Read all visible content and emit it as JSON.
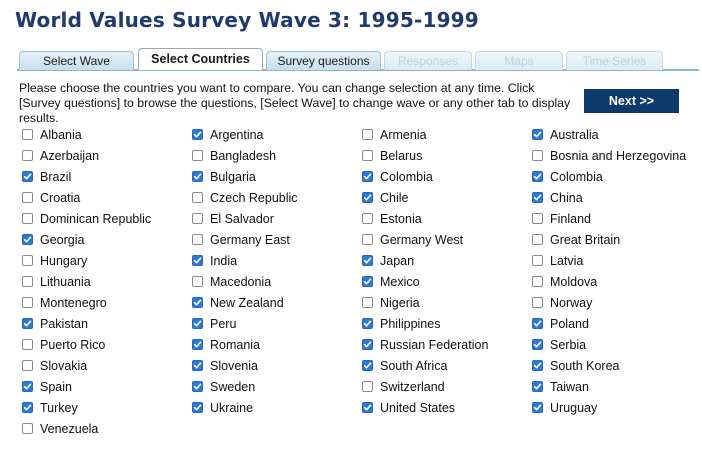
{
  "page": {
    "title": "World Values Survey Wave 3: 1995-1999"
  },
  "tabs": [
    {
      "label": "Select Wave",
      "state": "normal"
    },
    {
      "label": "Select Countries",
      "state": "active"
    },
    {
      "label": "Survey questions",
      "state": "normal"
    },
    {
      "label": "Responses",
      "state": "disabled"
    },
    {
      "label": "Maps",
      "state": "disabled"
    },
    {
      "label": "Time Series",
      "state": "disabled"
    }
  ],
  "instructions": "Please choose the countries you want to compare. You can change selection at any time. Click [Survey questions] to browse the questions, [Select Wave] to change wave or any other tab to display results.",
  "next_button": {
    "label": "Next >>"
  },
  "colors": {
    "title": "#1f3a6e",
    "next_button_bg": "#0d3a6b",
    "checkbox_checked": "#2d7ad6"
  },
  "countries": [
    [
      "Albania",
      false
    ],
    [
      "Argentina",
      true
    ],
    [
      "Armenia",
      false
    ],
    [
      "Australia",
      true
    ],
    [
      "Azerbaijan",
      false
    ],
    [
      "Bangladesh",
      false
    ],
    [
      "Belarus",
      false
    ],
    [
      "Bosnia and Herzegovina",
      false
    ],
    [
      "Brazil",
      true
    ],
    [
      "Bulgaria",
      true
    ],
    [
      "Colombia",
      true
    ],
    [
      "Colombia",
      true
    ],
    [
      "Croatia",
      false
    ],
    [
      "Czech Republic",
      false
    ],
    [
      "Chile",
      true
    ],
    [
      "China",
      true
    ],
    [
      "Dominican Republic",
      false
    ],
    [
      "El Salvador",
      false
    ],
    [
      "Estonia",
      false
    ],
    [
      "Finland",
      false
    ],
    [
      "Georgia",
      true
    ],
    [
      "Germany East",
      false
    ],
    [
      "Germany West",
      false
    ],
    [
      "Great Britain",
      false
    ],
    [
      "Hungary",
      false
    ],
    [
      "India",
      true
    ],
    [
      "Japan",
      true
    ],
    [
      "Latvia",
      false
    ],
    [
      "Lithuania",
      false
    ],
    [
      "Macedonia",
      false
    ],
    [
      "Mexico",
      true
    ],
    [
      "Moldova",
      false
    ],
    [
      "Montenegro",
      false
    ],
    [
      "New Zealand",
      true
    ],
    [
      "Nigeria",
      false
    ],
    [
      "Norway",
      false
    ],
    [
      "Pakistan",
      true
    ],
    [
      "Peru",
      true
    ],
    [
      "Philippines",
      true
    ],
    [
      "Poland",
      true
    ],
    [
      "Puerto Rico",
      false
    ],
    [
      "Romania",
      true
    ],
    [
      "Russian Federation",
      true
    ],
    [
      "Serbia",
      true
    ],
    [
      "Slovakia",
      false
    ],
    [
      "Slovenia",
      true
    ],
    [
      "South Africa",
      true
    ],
    [
      "South Korea",
      true
    ],
    [
      "Spain",
      true
    ],
    [
      "Sweden",
      true
    ],
    [
      "Switzerland",
      false
    ],
    [
      "Taiwan",
      true
    ],
    [
      "Turkey",
      true
    ],
    [
      "Ukraine",
      true
    ],
    [
      "United States",
      true
    ],
    [
      "Uruguay",
      true
    ],
    [
      "Venezuela",
      false
    ]
  ]
}
